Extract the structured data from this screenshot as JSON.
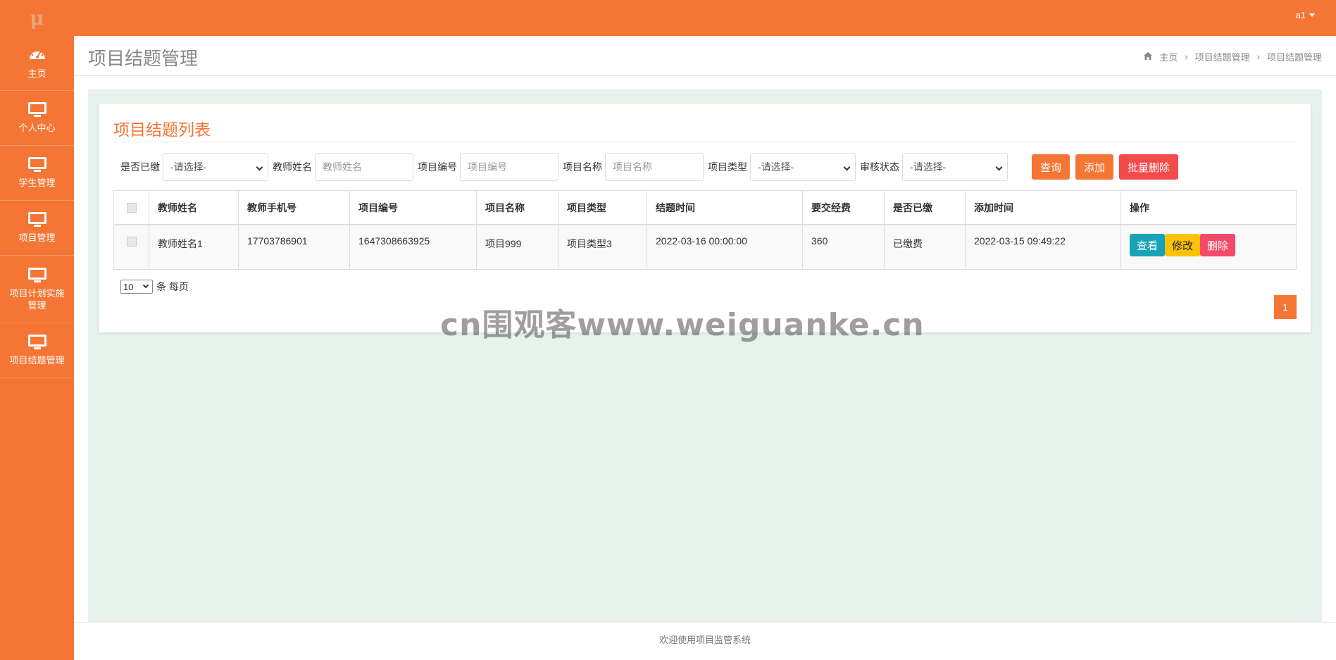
{
  "topbar": {
    "logo": "μ",
    "user": "a1"
  },
  "sidebar": {
    "items": [
      {
        "label": "主页",
        "icon": "dashboard-icon"
      },
      {
        "label": "个人中心",
        "icon": "monitor-icon"
      },
      {
        "label": "学生管理",
        "icon": "monitor-icon"
      },
      {
        "label": "项目管理",
        "icon": "monitor-icon"
      },
      {
        "label": "项目计划实施管理",
        "icon": "monitor-icon"
      },
      {
        "label": "项目结题管理",
        "icon": "monitor-icon"
      }
    ]
  },
  "header": {
    "title": "项目结题管理",
    "breadcrumb": [
      "主页",
      "项目结题管理",
      "项目结题管理"
    ]
  },
  "card": {
    "title": "项目结题列表"
  },
  "filters": {
    "paid_label": "是否已缴",
    "paid_value": "-请选择-",
    "teacher_label": "教师姓名",
    "teacher_placeholder": "教师姓名",
    "proj_no_label": "项目编号",
    "proj_no_placeholder": "项目编号",
    "proj_name_label": "项目名称",
    "proj_name_placeholder": "项目名称",
    "proj_type_label": "项目类型",
    "proj_type_value": "-请选择-",
    "audit_label": "审核状态",
    "audit_value": "-请选择-",
    "search_btn": "查询",
    "add_btn": "添加",
    "batch_del_btn": "批量删除"
  },
  "table": {
    "headers": [
      "教师姓名",
      "教师手机号",
      "项目编号",
      "项目名称",
      "项目类型",
      "结题时间",
      "要交经费",
      "是否已缴",
      "添加时间",
      "操作"
    ],
    "rows": [
      [
        "教师姓名1",
        "17703786901",
        "1647308663925",
        "项目999",
        "项目类型3",
        "2022-03-16 00:00:00",
        "360",
        "已缴费",
        "2022-03-15 09:49:22"
      ]
    ],
    "ops": {
      "view": "查看",
      "edit": "修改",
      "del": "删除"
    }
  },
  "paging": {
    "page_size": "10",
    "per_page_label": "条 每页",
    "current_page": "1"
  },
  "watermark": "cn围观客www.weiguanke.cn",
  "footer": "欢迎使用项目监管系统",
  "colors": {
    "primary": "#f47534",
    "bg_panel": "#e7f2ec",
    "view": "#17a2b8",
    "edit": "#ffc107",
    "delete": "#f34a6a"
  }
}
